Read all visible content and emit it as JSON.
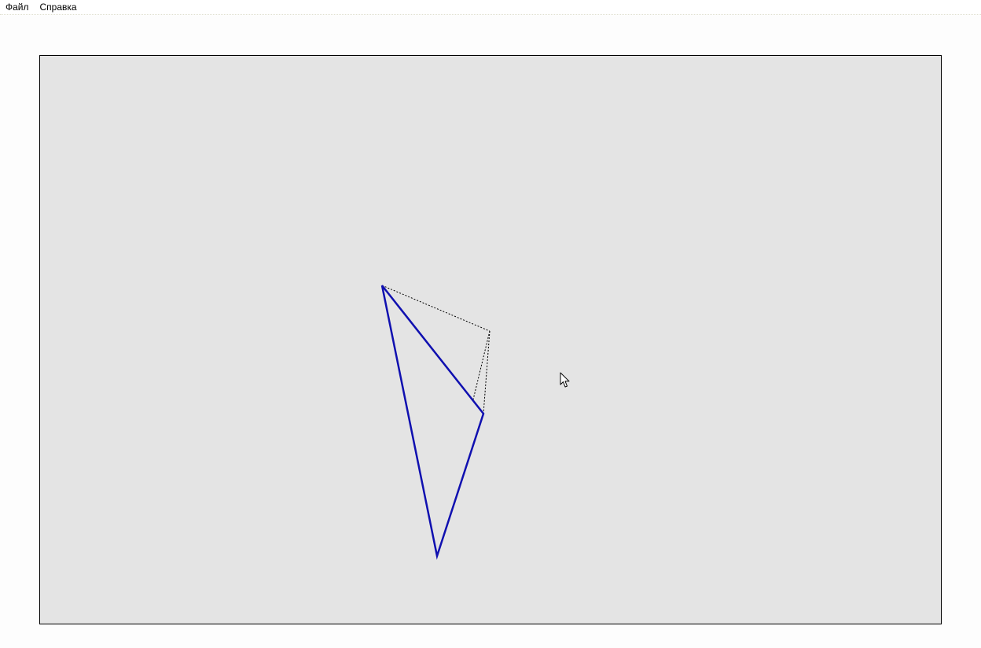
{
  "menubar": {
    "items": [
      {
        "label": "Файл"
      },
      {
        "label": "Справка"
      }
    ]
  },
  "canvas": {
    "background_color": "#e6e6e6",
    "border_color": "#000000",
    "triangle_color": "#1010b0",
    "guide_color": "#000000"
  },
  "cursor": {
    "icon": "arrow-cursor-icon"
  }
}
